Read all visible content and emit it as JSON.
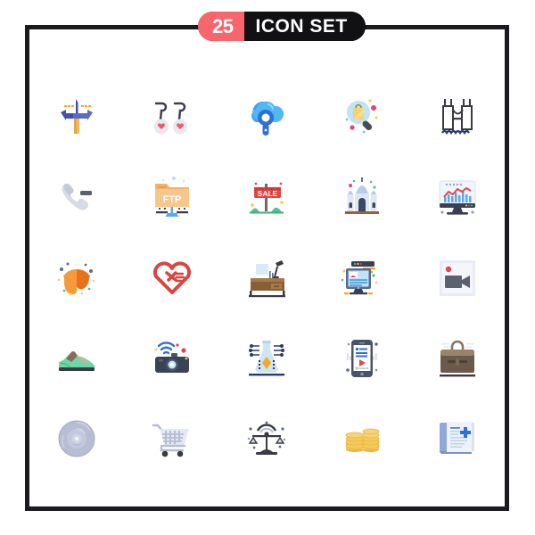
{
  "header": {
    "count": "25",
    "title": "ICON SET",
    "count_bg": "#f9656c",
    "title_bg": "#111114",
    "text_color": "#ffffff"
  },
  "frame": {
    "border_color": "#1b1b1f",
    "background": "#ffffff"
  },
  "icons": [
    {
      "name": "repair-tools-icon",
      "label": "repair tools",
      "row": 1,
      "col": 1,
      "colors": [
        "#3f51b5",
        "#f5a623",
        "#5c6bc0"
      ]
    },
    {
      "name": "earrings-icon",
      "label": "earrings",
      "row": 1,
      "col": 2,
      "colors": [
        "#3e3e4f",
        "#e4e4ec",
        "#ef5a68"
      ]
    },
    {
      "name": "cloud-search-icon",
      "label": "cloud search",
      "row": 1,
      "col": 3,
      "colors": [
        "#4fb8f5",
        "#2f6fd8",
        "#1f4fc0"
      ]
    },
    {
      "name": "shopping-search-icon",
      "label": "shopping bag search",
      "row": 1,
      "col": 4,
      "colors": [
        "#bfe3f7",
        "#f7d16b",
        "#4a4a58",
        "#ec4274"
      ]
    },
    {
      "name": "bridge-icon",
      "label": "bridge",
      "row": 1,
      "col": 5,
      "colors": [
        "#3a3a44",
        "#2b3a6b"
      ]
    },
    {
      "name": "phone-remove-icon",
      "label": "phone remove",
      "row": 2,
      "col": 1,
      "colors": [
        "#d7dbe6",
        "#5a5f6e"
      ]
    },
    {
      "name": "ftp-folder-icon",
      "label": "FTP folder",
      "row": 2,
      "col": 2,
      "text": "FTP",
      "colors": [
        "#f3b169",
        "#f6c68a",
        "#5aa9e8",
        "#2f3b52"
      ]
    },
    {
      "name": "sale-sign-icon",
      "label": "sale sign",
      "row": 2,
      "col": 3,
      "text": "SALE",
      "colors": [
        "#e8423f",
        "#6f6a66",
        "#4dc58a"
      ]
    },
    {
      "name": "mosque-icon",
      "label": "mosque",
      "row": 2,
      "col": 4,
      "colors": [
        "#dfe7f5",
        "#b9cbe6",
        "#3b4a63",
        "#a4583c"
      ]
    },
    {
      "name": "analytics-monitor-icon",
      "label": "analytics monitor",
      "row": 2,
      "col": 5,
      "colors": [
        "#f0f4fb",
        "#5aa9e8",
        "#e0484a",
        "#3a3f52"
      ]
    },
    {
      "name": "fortune-cookie-icon",
      "label": "fortune cookie",
      "row": 3,
      "col": 1,
      "colors": [
        "#e8721a",
        "#f59b3c",
        "#5a6b8c"
      ]
    },
    {
      "name": "heart-arrow-icon",
      "label": "heart with arrow",
      "row": 3,
      "col": 2,
      "colors": [
        "#d9453f"
      ]
    },
    {
      "name": "office-desk-icon",
      "label": "office desk with lamp",
      "row": 3,
      "col": 3,
      "colors": [
        "#a87848",
        "#8a5f36",
        "#3a3a44",
        "#d7eaf5"
      ]
    },
    {
      "name": "web-content-icon",
      "label": "web content monitor",
      "row": 3,
      "col": 4,
      "colors": [
        "#5a6b8c",
        "#bfe3f7",
        "#f5a623",
        "#ec4274"
      ]
    },
    {
      "name": "video-camera-icon",
      "label": "video camera",
      "row": 3,
      "col": 5,
      "colors": [
        "#e8ecf7",
        "#5a6170",
        "#e0484a"
      ]
    },
    {
      "name": "sneaker-icon",
      "label": "sneaker",
      "row": 4,
      "col": 1,
      "colors": [
        "#6dd6a6",
        "#8a6a56",
        "#3a3a44"
      ]
    },
    {
      "name": "wireless-camera-icon",
      "label": "wireless camera",
      "row": 4,
      "col": 2,
      "colors": [
        "#3a4256",
        "#5aa9e8",
        "#e0484a"
      ]
    },
    {
      "name": "science-circuit-icon",
      "label": "science flask circuit",
      "row": 4,
      "col": 3,
      "colors": [
        "#cfe6f2",
        "#f5a623",
        "#2b3a6b"
      ]
    },
    {
      "name": "mobile-video-icon",
      "label": "mobile video",
      "row": 4,
      "col": 4,
      "colors": [
        "#4a5468",
        "#bfe3f7",
        "#2f6fd8",
        "#e0484a"
      ]
    },
    {
      "name": "briefcase-icon",
      "label": "briefcase",
      "row": 4,
      "col": 5,
      "colors": [
        "#6b5a4a",
        "#8a7560",
        "#3a3a44"
      ]
    },
    {
      "name": "compact-disc-icon",
      "label": "compact disc",
      "row": 5,
      "col": 1,
      "colors": [
        "#b7bdd4",
        "#cfd4e6"
      ]
    },
    {
      "name": "shopping-cart-icon",
      "label": "shopping cart",
      "row": 5,
      "col": 2,
      "colors": [
        "#dfe3f0",
        "#b7bdd4",
        "#3a3a44"
      ]
    },
    {
      "name": "balance-scale-icon",
      "label": "balance scale",
      "row": 5,
      "col": 3,
      "colors": [
        "#3a3a44",
        "#d7dbe6",
        "#5a6b8c"
      ]
    },
    {
      "name": "coins-icon",
      "label": "coin stacks",
      "row": 5,
      "col": 4,
      "colors": [
        "#f5c95c",
        "#e8b63f"
      ]
    },
    {
      "name": "medical-book-icon",
      "label": "medical book",
      "row": 5,
      "col": 5,
      "colors": [
        "#8fa8d8",
        "#eef3fb",
        "#2f6fd8"
      ]
    }
  ]
}
